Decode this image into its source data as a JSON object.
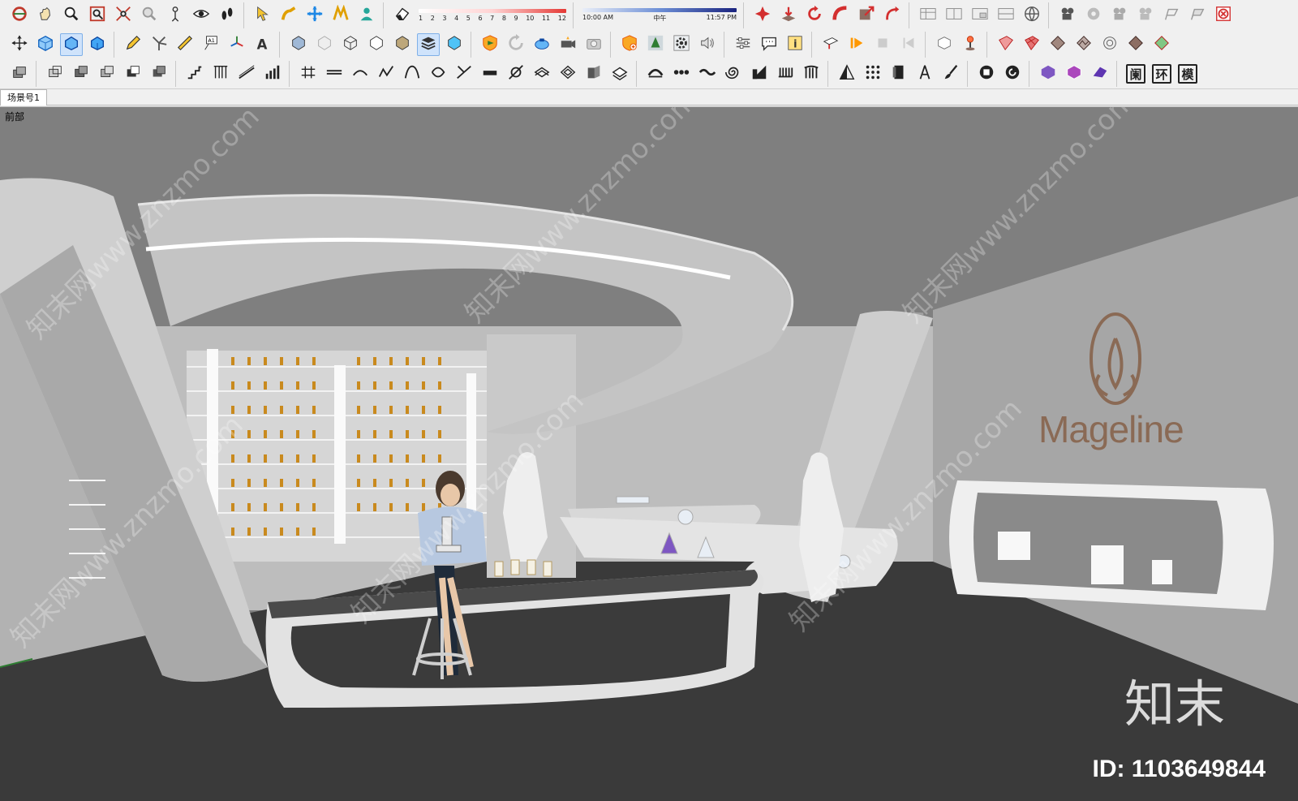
{
  "app": {
    "scene_tab_label": "场景号1",
    "view_label": "前部"
  },
  "toolbar": {
    "fog_scale_ticks": [
      "1",
      "2",
      "3",
      "4",
      "5",
      "6",
      "7",
      "8",
      "9",
      "10",
      "11",
      "12"
    ],
    "time_start": "10:00 AM",
    "time_mid": "中午",
    "time_end": "11:57 PM",
    "panel_labels": [
      "阑",
      "环",
      "模"
    ]
  },
  "scene": {
    "brand_logo_text": "Mageline",
    "watermark_text": "知末网www.znzmo.com"
  },
  "overlay": {
    "brand": "知末",
    "id_text": "ID: 1103649844"
  }
}
